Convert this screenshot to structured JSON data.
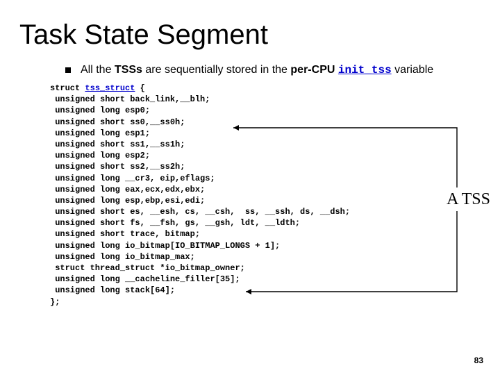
{
  "title": "Task State Segment",
  "bullet": {
    "prefix": "All the ",
    "bold1": "TSSs",
    "mid1": " are sequentially stored in the ",
    "bold2": "per-CPU",
    "mid2": " ",
    "code": "init_tss",
    "suffix": " variable"
  },
  "code": {
    "l0a": "struct ",
    "l0b": "tss_struct",
    "l0c": " {",
    "l1": " unsigned short back_link,__blh;",
    "l2": " unsigned long esp0;",
    "l3": " unsigned short ss0,__ss0h;",
    "l4": " unsigned long esp1;",
    "l5": " unsigned short ss1,__ss1h;",
    "l6": " unsigned long esp2;",
    "l7": " unsigned short ss2,__ss2h;",
    "l8": " unsigned long __cr3, eip,eflags;",
    "l9": " unsigned long eax,ecx,edx,ebx;",
    "l10": " unsigned long esp,ebp,esi,edi;",
    "l11": " unsigned short es, __esh, cs, __csh,  ss, __ssh, ds, __dsh;",
    "l12": " unsigned short fs, __fsh, gs, __gsh, ldt, __ldth;",
    "l13": " unsigned short trace, bitmap;",
    "l14": " unsigned long io_bitmap[IO_BITMAP_LONGS + 1];",
    "l15": " unsigned long io_bitmap_max;",
    "l16": " struct thread_struct *io_bitmap_owner;",
    "l17": " unsigned long __cacheline_filler[35];",
    "l18": " unsigned long stack[64];",
    "l19": "};"
  },
  "annotation": "A TSS",
  "page": "83"
}
